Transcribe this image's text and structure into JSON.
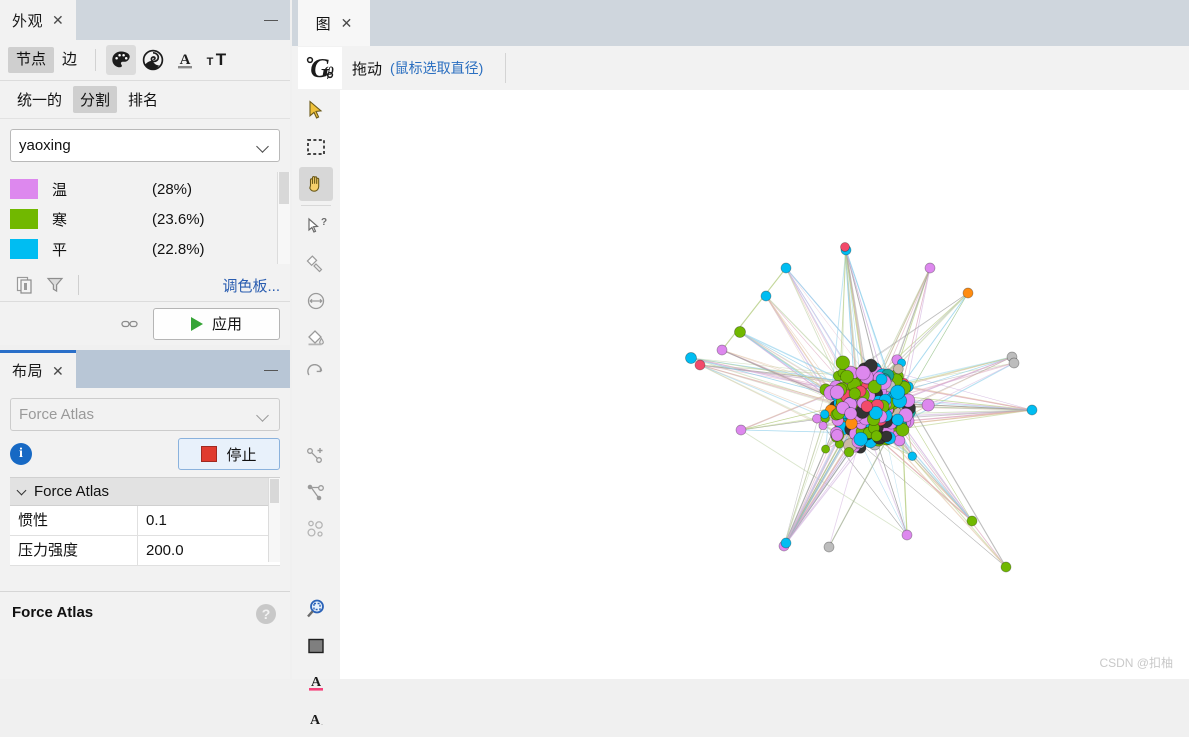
{
  "appearance_window": {
    "tab_label": "外观",
    "close_icon": "close-icon",
    "minimize_icon": "minimize-icon",
    "target_segments": [
      {
        "label": "节点",
        "selected": true
      },
      {
        "label": "边",
        "selected": false
      }
    ],
    "mode_icons": [
      {
        "name": "palette-icon",
        "glyph": "palette",
        "selected": true
      },
      {
        "name": "size-icon",
        "glyph": "spiral",
        "selected": false
      },
      {
        "name": "text-color-icon",
        "glyph": "A-underline",
        "selected": false
      },
      {
        "name": "text-size-icon",
        "glyph": "tT",
        "selected": false
      }
    ],
    "sub_tabs": [
      {
        "label": "统一的",
        "selected": false
      },
      {
        "label": "分割",
        "selected": true
      },
      {
        "label": "排名",
        "selected": false
      }
    ],
    "attribute_select": {
      "value": "yaoxing",
      "chevron": "chevron-down-icon"
    },
    "partitions": [
      {
        "label": "温",
        "percent": "(28%)",
        "color": "#dd88ee"
      },
      {
        "label": "寒",
        "percent": "(23.6%)",
        "color": "#71b800"
      },
      {
        "label": "平",
        "percent": "(22.8%)",
        "color": "#00bdf2"
      }
    ],
    "tool_icons": [
      {
        "name": "copy-icon"
      },
      {
        "name": "filter-funnel-icon"
      }
    ],
    "palette_link": "调色板...",
    "chain_icon": "link-icon",
    "apply_button": "应用"
  },
  "layout_window": {
    "tab_label": "布局",
    "close_icon": "close-icon",
    "minimize_icon": "minimize-icon",
    "layout_select": {
      "value": "Force Atlas",
      "chevron": "chevron-down-icon"
    },
    "info_icon": "info-icon",
    "stop_button": "停止",
    "properties_group": "Force Atlas",
    "properties": [
      {
        "key": "惯性",
        "value": "0.1"
      },
      {
        "key": "压力强度",
        "value": "200.0"
      }
    ],
    "description_title": "Force Atlas",
    "help_icon": "help-icon"
  },
  "graph_window": {
    "tab_label": "图",
    "close_icon": "close-icon",
    "logo_icon": "gephi-logo-icon",
    "mode_label": "拖动",
    "mode_hint": "(鼠标选取直径)",
    "vertical_tools": [
      {
        "name": "pointer-select-icon",
        "selected": false
      },
      {
        "name": "rectangle-select-icon",
        "selected": false
      },
      {
        "name": "drag-hand-icon",
        "selected": true
      },
      {
        "name": "node-inspect-icon",
        "selected": false
      },
      {
        "name": "brush-paint-icon",
        "selected": false
      },
      {
        "name": "node-size-icon",
        "selected": false
      },
      {
        "name": "paint-bucket-icon",
        "selected": false
      },
      {
        "name": "rotate-icon",
        "selected": false
      },
      {
        "name": "add-edge-icon",
        "selected": false
      },
      {
        "name": "shortest-path-icon",
        "selected": false
      },
      {
        "name": "heatmap-icon",
        "selected": false
      },
      {
        "name": "zoom-center-icon",
        "selected": false
      },
      {
        "name": "background-color-icon",
        "selected": false
      },
      {
        "name": "label-color-icon",
        "selected": false
      },
      {
        "name": "label-font-icon",
        "selected": false
      }
    ],
    "watermark": "CSDN @扣柚"
  },
  "chart_data": {
    "type": "scatter",
    "title": "Force Atlas network graph",
    "node_palette": {
      "温": "#dd88ee",
      "寒": "#71b800",
      "平": "#00bdf2",
      "other_orange": "#ff8c11",
      "other_dark": "#333333",
      "other_pink": "#f24a6a",
      "other_teal": "#14a699",
      "other_tan": "#cbb9a8",
      "other_gray": "#bdbdbd"
    },
    "categories": [
      "温",
      "寒",
      "平"
    ],
    "values": [
      28,
      23.6,
      22.8
    ],
    "xlabel": "",
    "ylabel": "",
    "grid": false,
    "legend_position": "sidebar"
  }
}
